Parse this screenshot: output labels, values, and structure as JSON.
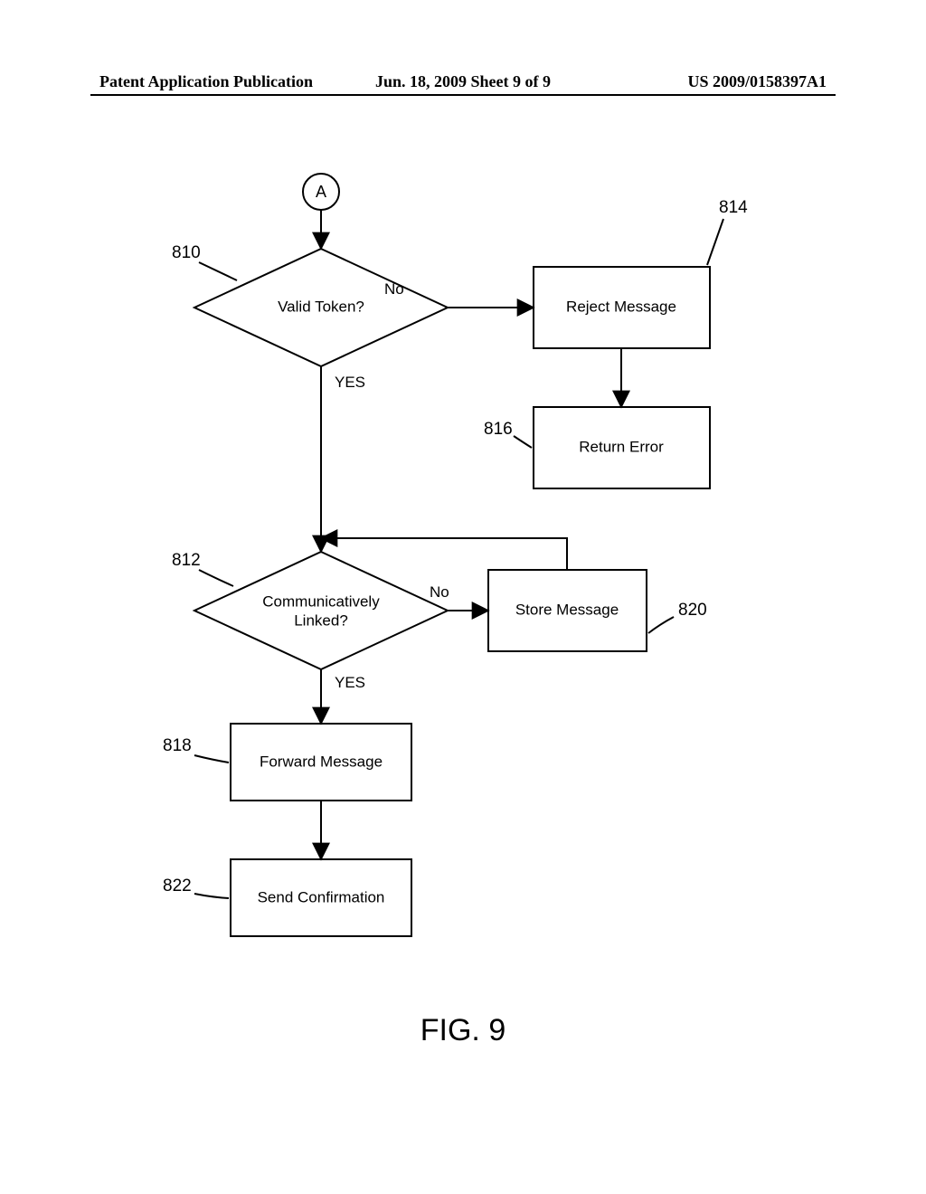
{
  "header": {
    "left": "Patent Application Publication",
    "mid": "Jun. 18, 2009   Sheet 9 of 9",
    "right": "US 2009/0158397A1"
  },
  "connector": {
    "label": "A"
  },
  "ref": {
    "n810": "810",
    "n812": "812",
    "n814": "814",
    "n816": "816",
    "n818": "818",
    "n820": "820",
    "n822": "822"
  },
  "boxes": {
    "d810": "Valid Token?",
    "d812_l1": "Communicatively",
    "d812_l2": "Linked?",
    "b814": "Reject Message",
    "b816": "Return Error",
    "b818": "Forward Message",
    "b820": "Store Message",
    "b822": "Send Confirmation"
  },
  "edges": {
    "no": "No",
    "yes": "YES"
  },
  "figure": "FIG.  9"
}
